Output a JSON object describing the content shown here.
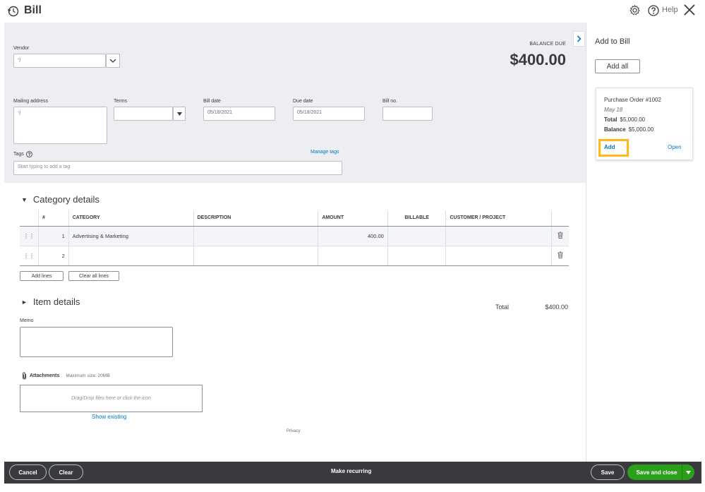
{
  "header": {
    "title": "Bill",
    "help_label": "Help"
  },
  "form": {
    "vendor_label": "Vendor",
    "vendor_value": "-j",
    "balance_due_label": "BALANCE DUE",
    "balance_due_value": "$400.00",
    "mailing_address_label": "Mailing address",
    "mailing_address_value": "-j",
    "terms_label": "Terms",
    "terms_value": "",
    "bill_date_label": "Bill date",
    "bill_date_value": "05/18/2021",
    "due_date_label": "Due date",
    "due_date_value": "05/18/2021",
    "bill_no_label": "Bill no.",
    "bill_no_value": "",
    "tags_label": "Tags",
    "manage_tags_label": "Manage tags",
    "tags_placeholder": "Start typing to add a tag"
  },
  "category_details": {
    "title": "Category details",
    "columns": [
      "#",
      "CATEGORY",
      "DESCRIPTION",
      "AMOUNT",
      "BILLABLE",
      "CUSTOMER / PROJECT"
    ],
    "rows": [
      {
        "num": "1",
        "category": "Advertising & Marketing",
        "description": "",
        "amount": "400.00",
        "billable": "",
        "customer": ""
      },
      {
        "num": "2",
        "category": "",
        "description": "",
        "amount": "",
        "billable": "",
        "customer": ""
      }
    ],
    "add_lines_label": "Add lines",
    "clear_all_lines_label": "Clear all lines"
  },
  "item_details": {
    "title": "Item details"
  },
  "totals": {
    "total_label": "Total",
    "total_value": "$400.00"
  },
  "memo": {
    "label": "Memo"
  },
  "attachments": {
    "label": "Attachments",
    "max_size": "Maximum size: 20MB",
    "dropzone_text": "Drag/Drop files here or click the icon",
    "show_existing": "Show existing"
  },
  "privacy_label": "Privacy",
  "side_panel": {
    "title": "Add to Bill",
    "add_all_label": "Add all",
    "purchase_order": {
      "title": "Purchase Order #1002",
      "date": "May 18",
      "total_label": "Total",
      "total_value": "$5,000.00",
      "balance_label": "Balance",
      "balance_value": "$5,000.00",
      "add_label": "Add",
      "open_label": "Open"
    },
    "highlight_color": "#ffba1a"
  },
  "footer": {
    "cancel_label": "Cancel",
    "clear_label": "Clear",
    "make_recurring_label": "Make recurring",
    "save_label": "Save",
    "save_close_label": "Save and close"
  },
  "colors": {
    "brand_green": "#2ca01c",
    "link_blue": "#0077c5",
    "footer_bg": "#393a3d",
    "panel_grey": "#eceef1"
  }
}
